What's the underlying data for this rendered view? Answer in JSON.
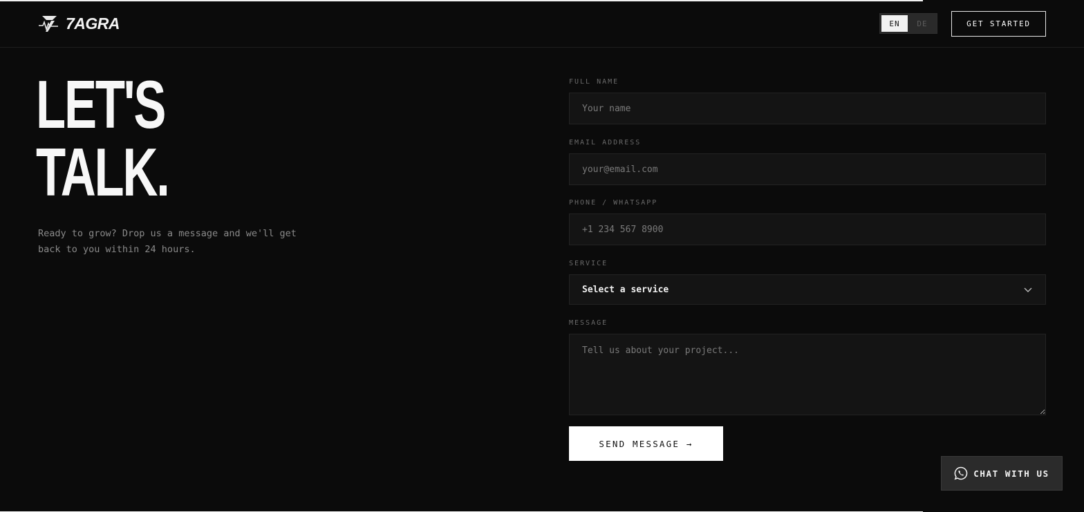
{
  "brand": {
    "name": "7AGRA",
    "logo_icon": "lightning-heartbeat-icon"
  },
  "header": {
    "languages": [
      {
        "code": "EN",
        "active": true
      },
      {
        "code": "DE",
        "active": false
      }
    ],
    "cta_label": "GET STARTED"
  },
  "hero": {
    "title_line1": "LET'S",
    "title_line2": "TALK.",
    "subtitle": "Ready to grow? Drop us a message and we'll get back to you within 24 hours."
  },
  "form": {
    "name": {
      "label": "FULL NAME",
      "placeholder": "Your name",
      "value": ""
    },
    "email": {
      "label": "EMAIL ADDRESS",
      "placeholder": "your@email.com",
      "value": ""
    },
    "phone": {
      "label": "PHONE / WHATSAPP",
      "placeholder": "+1 234 567 8900",
      "value": ""
    },
    "service": {
      "label": "SERVICE",
      "selected": "Select a service",
      "icon": "chevron-down-icon"
    },
    "message": {
      "label": "MESSAGE",
      "placeholder": "Tell us about your project...",
      "value": ""
    },
    "submit_label": "SEND MESSAGE →"
  },
  "chat": {
    "label": "CHAT WITH US",
    "icon": "whatsapp-icon"
  },
  "colors": {
    "background": "#0b0b0b",
    "field_background": "#141414",
    "accent": "#ffffff",
    "muted_text": "#8a8a8a"
  }
}
